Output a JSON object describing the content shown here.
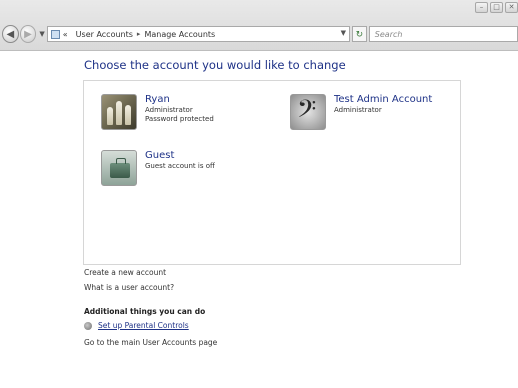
{
  "window": {
    "caption": {
      "minimize": "–",
      "maximize": "□",
      "close": "✕"
    }
  },
  "navbar": {
    "back_icon": "back-arrow",
    "forward_icon": "forward-arrow",
    "address": {
      "icon": "control-panel-icon",
      "overflow": "«",
      "crumbs": [
        "User Accounts",
        "Manage Accounts"
      ],
      "separator": "▸"
    },
    "refresh_glyph": "↻",
    "search_placeholder": "Search"
  },
  "main": {
    "heading": "Choose the account you would like to change",
    "accounts": [
      {
        "name": "Ryan",
        "lines": [
          "Administrator",
          "Password protected"
        ],
        "picture": "chess-pieces"
      },
      {
        "name": "Test Admin Account",
        "lines": [
          "Administrator"
        ],
        "picture": "bass-clef"
      },
      {
        "name": "Guest",
        "lines": [
          "Guest account is off"
        ],
        "picture": "briefcase"
      }
    ],
    "links": {
      "create": "Create a new account",
      "what_is": "What is a user account?"
    },
    "additional": {
      "title": "Additional things you can do",
      "parental": "Set up Parental Controls",
      "main_page": "Go to the main User Accounts page"
    }
  }
}
